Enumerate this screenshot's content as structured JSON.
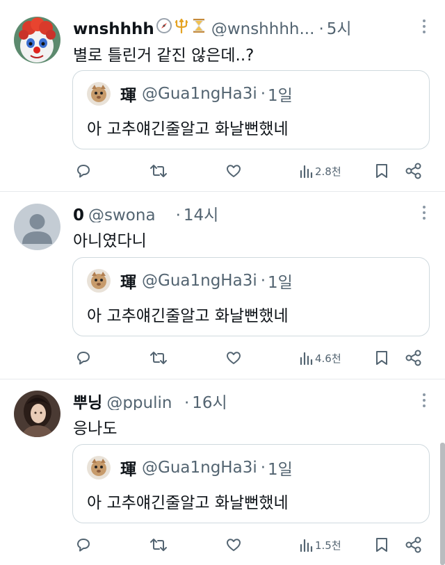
{
  "icons": {
    "reply": "reply-icon",
    "retweet": "retweet-icon",
    "like": "like-icon",
    "views": "views-icon",
    "bookmark": "bookmark-icon",
    "share": "share-icon",
    "more": "more-icon"
  },
  "colors": {
    "text": "#0f1419",
    "secondary": "#536471",
    "border": "#cfd9de",
    "divider": "#e7e9ec"
  },
  "quoted": {
    "name": "琿",
    "handle": "@Gua1ngHa3i",
    "time": "1일",
    "text": "아 고추얘긴줄알고 화날뻔했네"
  },
  "tweets": [
    {
      "name": "wnshhhh",
      "emojis": [
        "🧭",
        "🔱",
        "⏳"
      ],
      "handle": "@wnshhhh...",
      "time": "5시",
      "text": "별로 틀린거 같진 않은데..?",
      "views": "2.8천"
    },
    {
      "name": "0",
      "emojis": [],
      "handle": "@swona__",
      "time": "14시",
      "text": "아니였다니",
      "views": "4.6천"
    },
    {
      "name": "뿌닝",
      "emojis": [],
      "handle": "@ppulin_",
      "time": "16시",
      "text": "응나도",
      "views": "1.5천"
    }
  ]
}
